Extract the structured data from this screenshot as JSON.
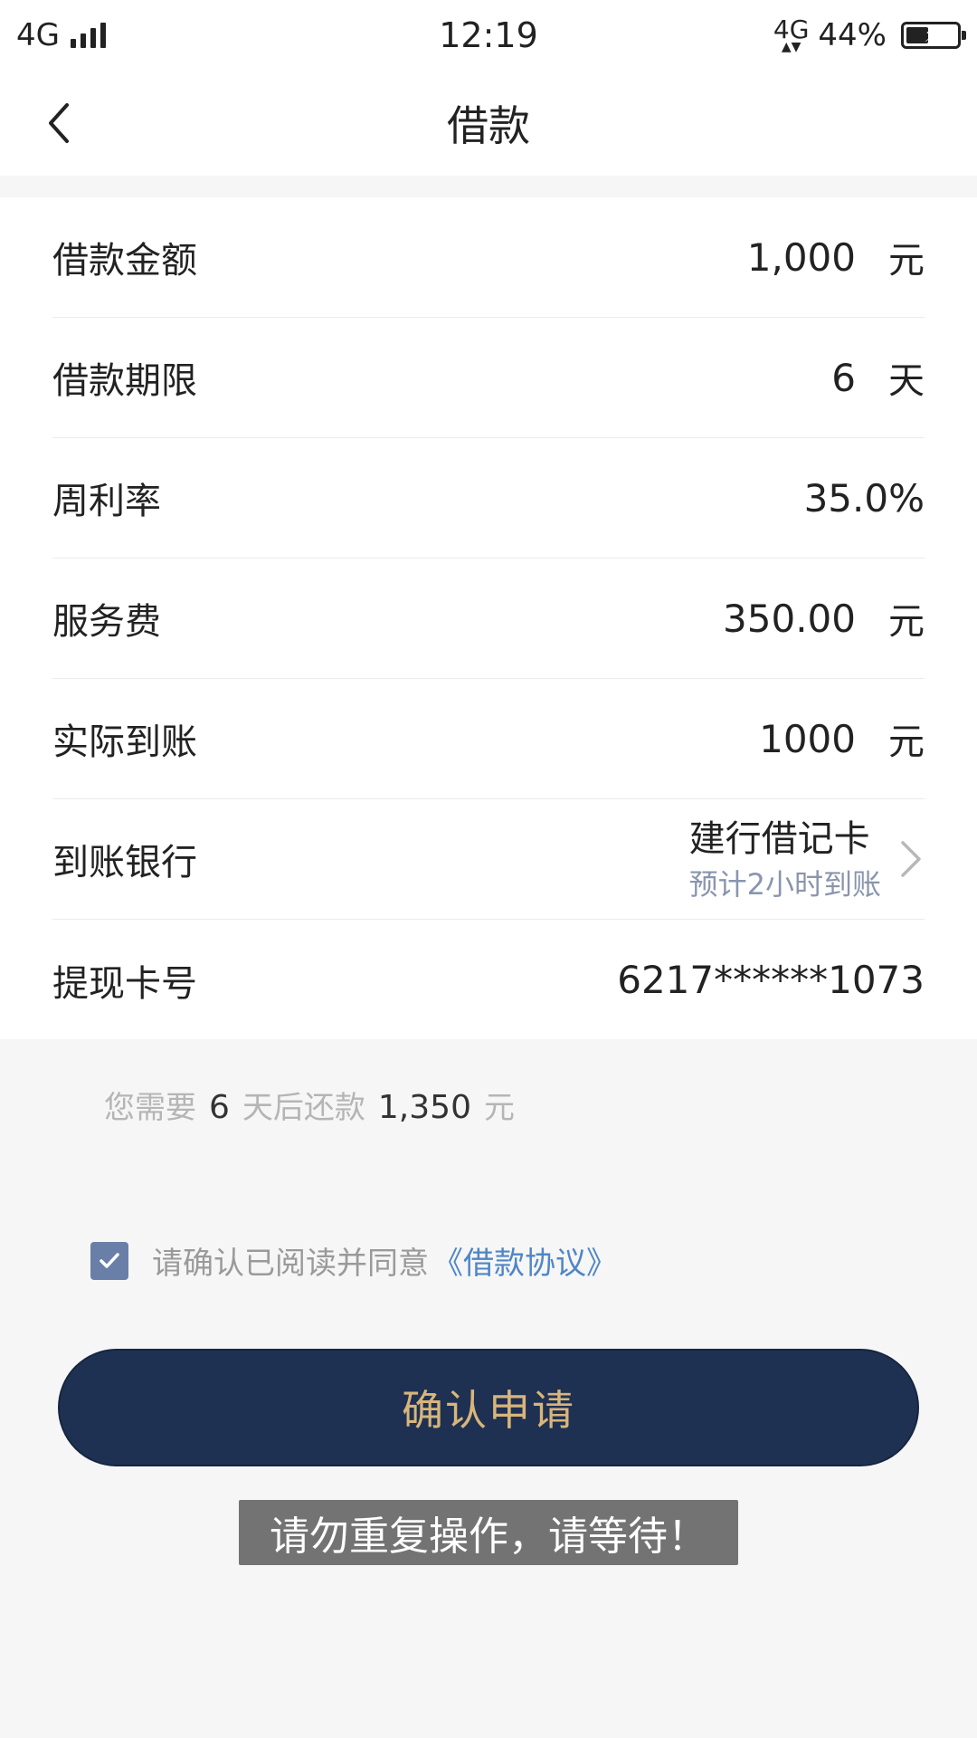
{
  "status_bar": {
    "network": "4G",
    "time": "12:19",
    "network_right": "4G",
    "battery_percent": "44%",
    "battery_level": 0.44
  },
  "nav": {
    "title": "借款"
  },
  "rows": [
    {
      "label": "借款金额",
      "value": "1,000",
      "unit": "元"
    },
    {
      "label": "借款期限",
      "value": "6",
      "unit": "天"
    },
    {
      "label": "周利率",
      "value": "35.0%",
      "unit": ""
    },
    {
      "label": "服务费",
      "value": "350.00",
      "unit": "元"
    },
    {
      "label": "实际到账",
      "value": "1000",
      "unit": "元"
    },
    {
      "label": "到账银行",
      "bank_name": "建行借记卡",
      "bank_sub": "预计2小时到账"
    },
    {
      "label": "提现卡号",
      "value": "6217******1073",
      "unit": ""
    }
  ],
  "summary": {
    "prefix": "您需要",
    "days": "6",
    "middle": "天后还款",
    "amount": "1,350",
    "suffix": "元"
  },
  "agreement": {
    "text": "请确认已阅读并同意",
    "link": "《借款协议》",
    "checked": true
  },
  "submit": {
    "label": "确认申请"
  },
  "toast": {
    "text": "请勿重复操作，请等待！"
  },
  "colors": {
    "button_bg": "#1f3152",
    "button_text": "#d8b57a",
    "link": "#4f86c6",
    "checkbox": "#6a7fa8"
  }
}
